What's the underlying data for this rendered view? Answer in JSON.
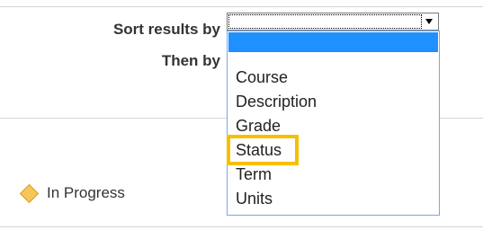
{
  "sort": {
    "primary_label": "Sort results by",
    "secondary_label": "Then by",
    "selected_value": ""
  },
  "dropdown": {
    "options": [
      "",
      "Course",
      "Description",
      "Grade",
      "Status",
      "Term",
      "Units"
    ],
    "highlighted_option": "",
    "callout_option": "Status"
  },
  "legend": {
    "in_progress_label": "In Progress",
    "in_progress_icon": "diamond-icon",
    "in_progress_color": "#f7c65a"
  },
  "colors": {
    "dropdown_selection": "#1e90ff",
    "callout_border": "#f6c000"
  }
}
